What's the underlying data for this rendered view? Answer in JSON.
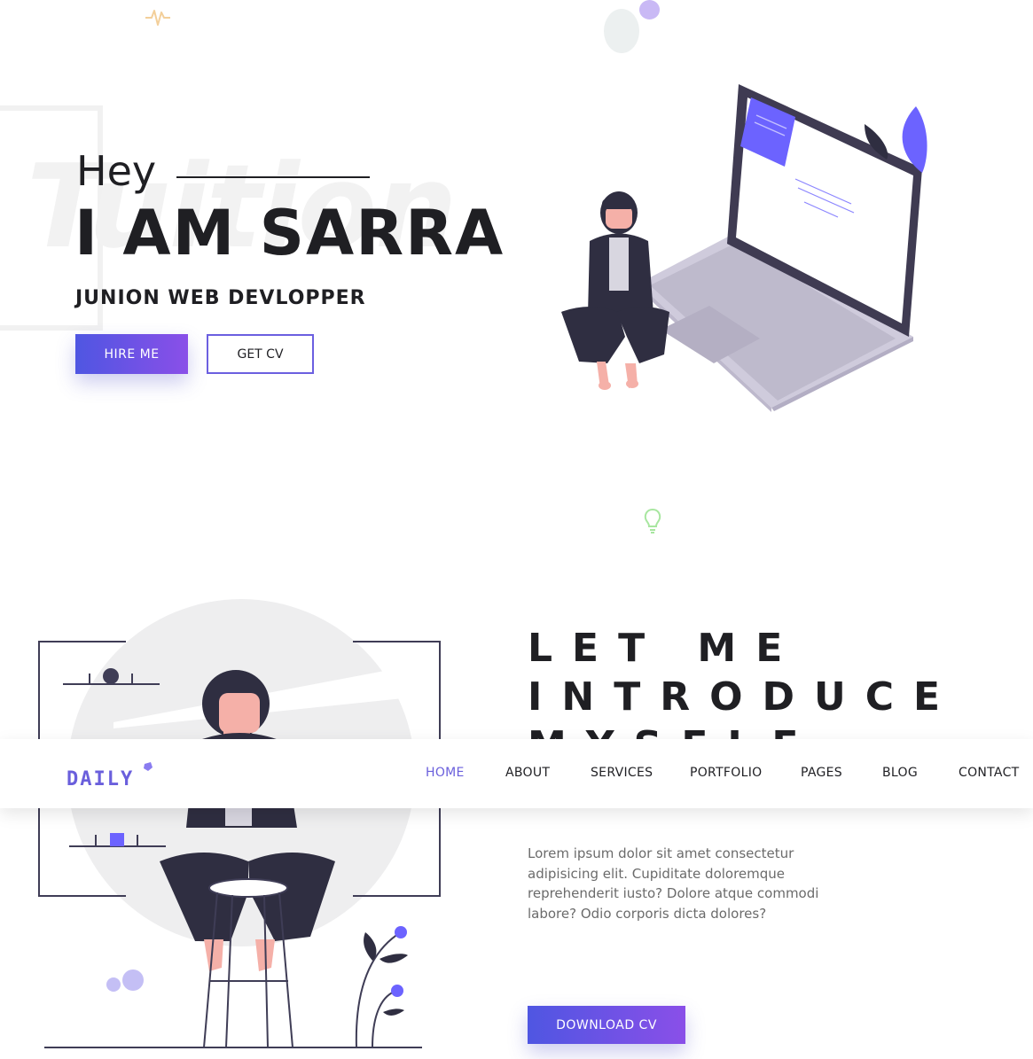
{
  "hero": {
    "watermark": "Tuition",
    "greeting": "Hey",
    "name": "I AM SARRA",
    "role": "JUNION WEB DEVLOPPER",
    "hire_label": "HIRE ME",
    "cv_label": "GET CV"
  },
  "about": {
    "heading": "LET ME INTRODUCE MYSELF",
    "text": "Lorem ipsum dolor sit amet consectetur adipisicing elit. Cupiditate doloremque reprehenderit iusto? Dolore atque commodi labore? Odio corporis dicta dolores?",
    "download_label": "DOWNLOAD CV"
  },
  "nav": {
    "logo": "DAILY",
    "items": [
      {
        "label": "HOME",
        "active": true
      },
      {
        "label": "ABOUT"
      },
      {
        "label": "SERVICES"
      },
      {
        "label": "PORTFOLIO"
      },
      {
        "label": "PAGES"
      },
      {
        "label": "BLOG"
      },
      {
        "label": "CONTACT"
      }
    ]
  },
  "colors": {
    "accent": "#6a5fdc",
    "gradient_start": "#4f56e2",
    "gradient_end": "#8a4fe8",
    "text_dark": "#1f1f23"
  }
}
